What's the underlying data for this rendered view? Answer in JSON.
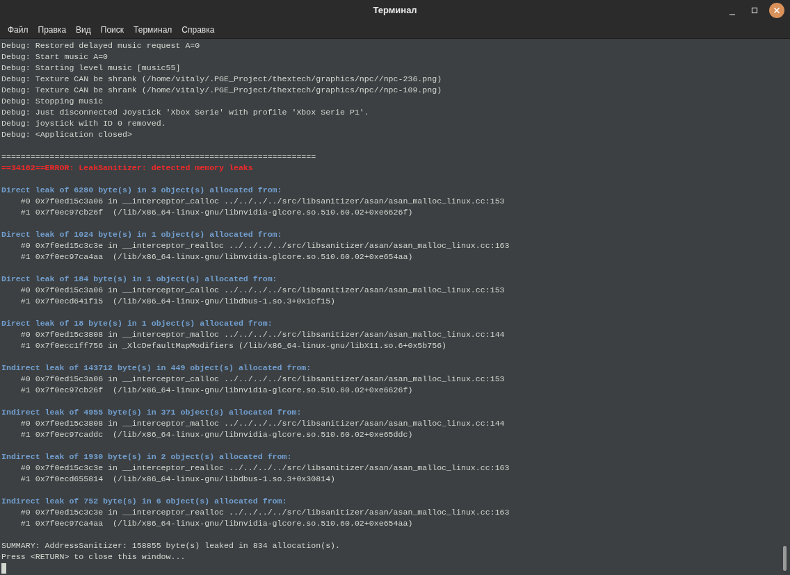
{
  "window": {
    "title": "Терминал"
  },
  "menu": [
    "Файл",
    "Правка",
    "Вид",
    "Поиск",
    "Терминал",
    "Справка"
  ],
  "lines": [
    {
      "kind": "text",
      "text": "Debug: Restored delayed music request A=0"
    },
    {
      "kind": "text",
      "text": "Debug: Start music A=0"
    },
    {
      "kind": "text",
      "text": "Debug: Starting level music [music55]"
    },
    {
      "kind": "text",
      "text": "Debug: Texture CAN be shrank (/home/vitaly/.PGE_Project/thextech/graphics/npc//npc-236.png)"
    },
    {
      "kind": "text",
      "text": "Debug: Texture CAN be shrank (/home/vitaly/.PGE_Project/thextech/graphics/npc//npc-109.png)"
    },
    {
      "kind": "text",
      "text": "Debug: Stopping music"
    },
    {
      "kind": "text",
      "text": "Debug: Just disconnected Joystick 'Xbox Serie' with profile 'Xbox Serie P1'."
    },
    {
      "kind": "text",
      "text": "Debug: joystick with ID 0 removed."
    },
    {
      "kind": "text",
      "text": "Debug: <Application closed>"
    },
    {
      "kind": "blank"
    },
    {
      "kind": "text",
      "text": "================================================================="
    },
    {
      "kind": "error",
      "text": "==34182==ERROR: LeakSanitizer: detected memory leaks"
    },
    {
      "kind": "blank"
    },
    {
      "kind": "header",
      "text": "Direct leak of 6280 byte(s) in 3 object(s) allocated from:"
    },
    {
      "kind": "text",
      "text": "    #0 0x7f0ed15c3a06 in __interceptor_calloc ../../../../src/libsanitizer/asan/asan_malloc_linux.cc:153"
    },
    {
      "kind": "text",
      "text": "    #1 0x7f0ec97cb26f  (/lib/x86_64-linux-gnu/libnvidia-glcore.so.510.60.02+0xe6626f)"
    },
    {
      "kind": "blank"
    },
    {
      "kind": "header",
      "text": "Direct leak of 1024 byte(s) in 1 object(s) allocated from:"
    },
    {
      "kind": "text",
      "text": "    #0 0x7f0ed15c3c3e in __interceptor_realloc ../../../../src/libsanitizer/asan/asan_malloc_linux.cc:163"
    },
    {
      "kind": "text",
      "text": "    #1 0x7f0ec97ca4aa  (/lib/x86_64-linux-gnu/libnvidia-glcore.so.510.60.02+0xe654aa)"
    },
    {
      "kind": "blank"
    },
    {
      "kind": "header",
      "text": "Direct leak of 184 byte(s) in 1 object(s) allocated from:"
    },
    {
      "kind": "text",
      "text": "    #0 0x7f0ed15c3a06 in __interceptor_calloc ../../../../src/libsanitizer/asan/asan_malloc_linux.cc:153"
    },
    {
      "kind": "text",
      "text": "    #1 0x7f0ecd641f15  (/lib/x86_64-linux-gnu/libdbus-1.so.3+0x1cf15)"
    },
    {
      "kind": "blank"
    },
    {
      "kind": "header",
      "text": "Direct leak of 18 byte(s) in 1 object(s) allocated from:"
    },
    {
      "kind": "text",
      "text": "    #0 0x7f0ed15c3808 in __interceptor_malloc ../../../../src/libsanitizer/asan/asan_malloc_linux.cc:144"
    },
    {
      "kind": "text",
      "text": "    #1 0x7f0ecc1ff756 in _XlcDefaultMapModifiers (/lib/x86_64-linux-gnu/libX11.so.6+0x5b756)"
    },
    {
      "kind": "blank"
    },
    {
      "kind": "header",
      "text": "Indirect leak of 143712 byte(s) in 449 object(s) allocated from:"
    },
    {
      "kind": "text",
      "text": "    #0 0x7f0ed15c3a06 in __interceptor_calloc ../../../../src/libsanitizer/asan/asan_malloc_linux.cc:153"
    },
    {
      "kind": "text",
      "text": "    #1 0x7f0ec97cb26f  (/lib/x86_64-linux-gnu/libnvidia-glcore.so.510.60.02+0xe6626f)"
    },
    {
      "kind": "blank"
    },
    {
      "kind": "header",
      "text": "Indirect leak of 4955 byte(s) in 371 object(s) allocated from:"
    },
    {
      "kind": "text",
      "text": "    #0 0x7f0ed15c3808 in __interceptor_malloc ../../../../src/libsanitizer/asan/asan_malloc_linux.cc:144"
    },
    {
      "kind": "text",
      "text": "    #1 0x7f0ec97caddc  (/lib/x86_64-linux-gnu/libnvidia-glcore.so.510.60.02+0xe65ddc)"
    },
    {
      "kind": "blank"
    },
    {
      "kind": "header",
      "text": "Indirect leak of 1930 byte(s) in 2 object(s) allocated from:"
    },
    {
      "kind": "text",
      "text": "    #0 0x7f0ed15c3c3e in __interceptor_realloc ../../../../src/libsanitizer/asan/asan_malloc_linux.cc:163"
    },
    {
      "kind": "text",
      "text": "    #1 0x7f0ecd655814  (/lib/x86_64-linux-gnu/libdbus-1.so.3+0x30814)"
    },
    {
      "kind": "blank"
    },
    {
      "kind": "header",
      "text": "Indirect leak of 752 byte(s) in 6 object(s) allocated from:"
    },
    {
      "kind": "text",
      "text": "    #0 0x7f0ed15c3c3e in __interceptor_realloc ../../../../src/libsanitizer/asan/asan_malloc_linux.cc:163"
    },
    {
      "kind": "text",
      "text": "    #1 0x7f0ec97ca4aa  (/lib/x86_64-linux-gnu/libnvidia-glcore.so.510.60.02+0xe654aa)"
    },
    {
      "kind": "blank"
    },
    {
      "kind": "text",
      "text": "SUMMARY: AddressSanitizer: 158855 byte(s) leaked in 834 allocation(s)."
    },
    {
      "kind": "text",
      "text": "Press <RETURN> to close this window..."
    },
    {
      "kind": "cursor"
    }
  ]
}
